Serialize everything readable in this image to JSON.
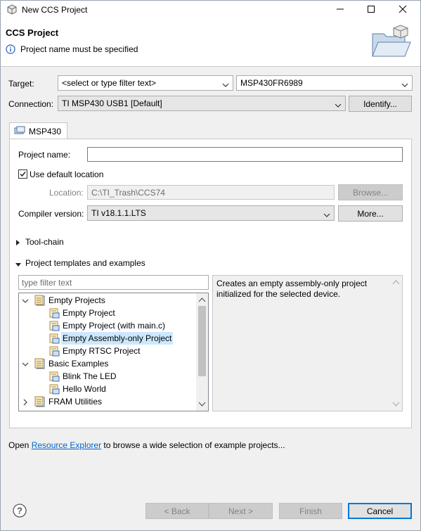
{
  "window": {
    "title": "New CCS Project",
    "minimize_glyph": "—",
    "maximize_glyph": "☐",
    "close_glyph": "✕"
  },
  "header": {
    "title": "CCS Project",
    "message": "Project name must be specified",
    "info_icon": "info-icon",
    "wizard_image": "folder-wizard-icon"
  },
  "target": {
    "label": "Target:",
    "filter_value": "<select or type filter text>",
    "device_value": "MSP430FR6989"
  },
  "connection": {
    "label": "Connection:",
    "value": "TI MSP430 USB1 [Default]",
    "identify_label": "Identify..."
  },
  "tab": {
    "label": "MSP430"
  },
  "project": {
    "name_label": "Project name:",
    "name_value": "",
    "use_default_location_label": "Use default location",
    "use_default_location_checked": true,
    "location_label": "Location:",
    "location_value": "C:\\TI_Trash\\CCS74",
    "browse_label": "Browse...",
    "compiler_label": "Compiler version:",
    "compiler_value": "TI v18.1.1.LTS",
    "more_label": "More..."
  },
  "sections": {
    "toolchain_label": "Tool-chain",
    "templates_label": "Project templates and examples"
  },
  "templates": {
    "filter_placeholder": "type filter text",
    "tree": [
      {
        "label": "Empty Projects",
        "level": 0,
        "expanded": true,
        "folder": true
      },
      {
        "label": "Empty Project",
        "level": 1,
        "folder": false
      },
      {
        "label": "Empty Project (with main.c)",
        "level": 1,
        "folder": false
      },
      {
        "label": "Empty Assembly-only Project",
        "level": 1,
        "folder": false,
        "selected": true
      },
      {
        "label": "Empty RTSC Project",
        "level": 1,
        "folder": false
      },
      {
        "label": "Basic Examples",
        "level": 0,
        "expanded": true,
        "folder": true
      },
      {
        "label": "Blink The LED",
        "level": 1,
        "folder": false
      },
      {
        "label": "Hello World",
        "level": 1,
        "folder": false
      },
      {
        "label": "FRAM Utilities",
        "level": 0,
        "expanded": false,
        "folder": true
      }
    ],
    "description": "Creates an empty assembly-only project initialized for the selected device."
  },
  "footer": {
    "open_text": "Open ",
    "resource_explorer_link": "Resource Explorer",
    "rest_text": " to browse a wide selection of example projects...",
    "help_glyph": "?",
    "back_label": "< Back",
    "next_label": "Next >",
    "finish_label": "Finish",
    "cancel_label": "Cancel"
  },
  "colors": {
    "accent_selection": "#cce8ff",
    "link": "#0066cc",
    "default_button_border": "#0078d7"
  }
}
